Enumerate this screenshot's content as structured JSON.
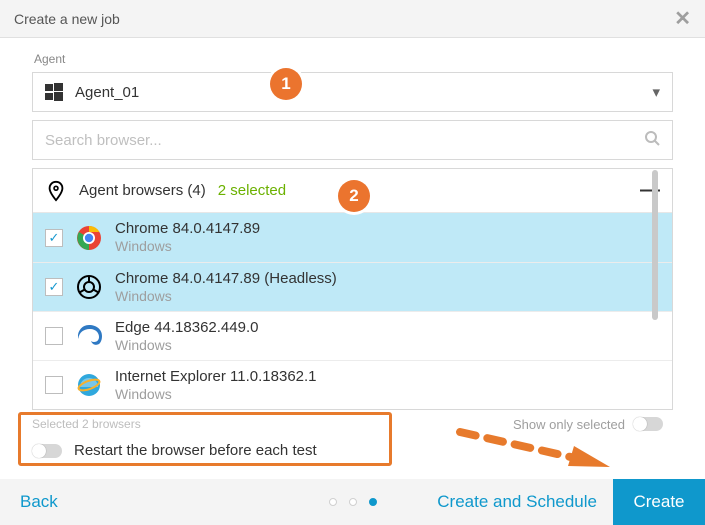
{
  "header": {
    "title": "Create a new job"
  },
  "agent": {
    "label": "Agent",
    "value": "Agent_01"
  },
  "search": {
    "placeholder": "Search browser..."
  },
  "group": {
    "title": "Agent browsers (4)",
    "selected_text": "2 selected"
  },
  "browsers": [
    {
      "name": "Chrome 84.0.4147.89",
      "os": "Windows",
      "selected": true,
      "icon": "chrome"
    },
    {
      "name": "Chrome 84.0.4147.89 (Headless)",
      "os": "Windows",
      "selected": true,
      "icon": "chrome-headless"
    },
    {
      "name": "Edge 44.18362.449.0",
      "os": "Windows",
      "selected": false,
      "icon": "edge"
    },
    {
      "name": "Internet Explorer 11.0.18362.1",
      "os": "Windows",
      "selected": false,
      "icon": "ie"
    }
  ],
  "selected_summary": "Selected 2 browsers",
  "show_only_selected": "Show only selected",
  "restart_label": "Restart the browser before each test",
  "footer": {
    "back": "Back",
    "create_schedule": "Create and Schedule",
    "create": "Create"
  },
  "markers": {
    "one": "1",
    "two": "2"
  },
  "colors": {
    "accent": "#0f98cc",
    "orange": "#e77a2c",
    "green": "#6bb100"
  }
}
